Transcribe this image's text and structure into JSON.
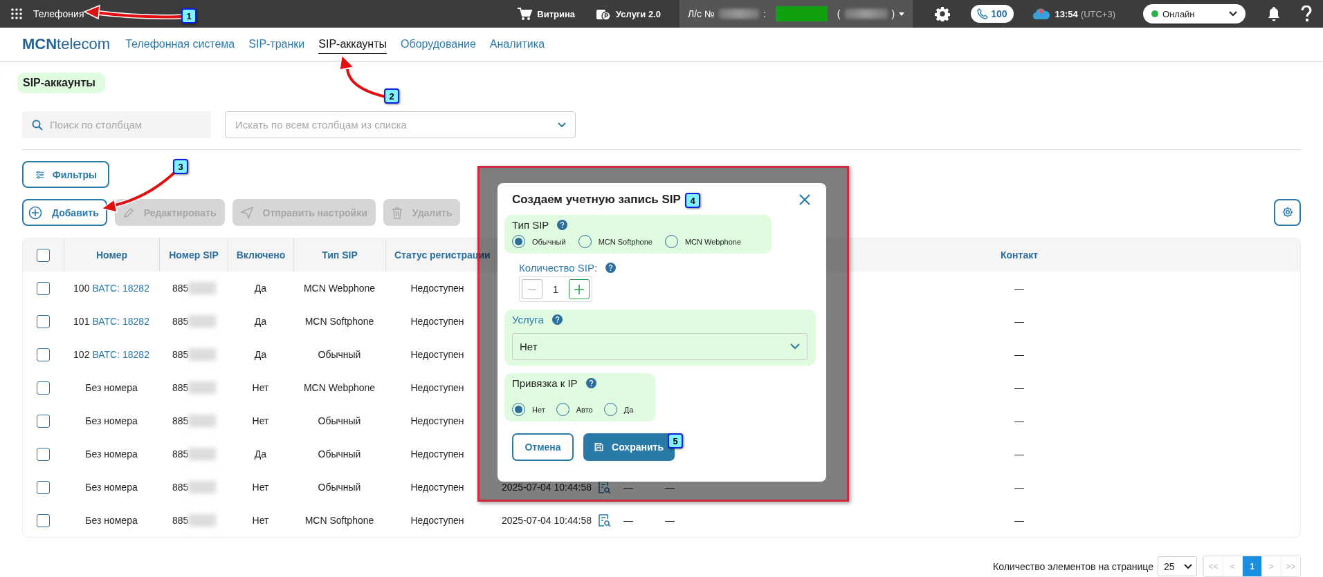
{
  "top_bar": {
    "app_title": "Телефония",
    "links": [
      {
        "label": "Витрина",
        "kind": "cart"
      },
      {
        "label": "Услуги 2.0",
        "kind": "services"
      }
    ],
    "account": {
      "prefix": "Л/с №",
      "separator": ":",
      "open_paren": "(",
      "close_paren": ")"
    },
    "calls_count": "100",
    "time": "13:54",
    "timezone": "(UTC+3)",
    "status": "Онлайн"
  },
  "brand": {
    "strong": "MCN",
    "light": "telecom"
  },
  "nav": [
    {
      "label": "Телефонная система",
      "selected": false
    },
    {
      "label": "SIP-транки",
      "selected": false
    },
    {
      "label": "SIP-аккаунты",
      "selected": true
    },
    {
      "label": "Оборудование",
      "selected": false
    },
    {
      "label": "Аналитика",
      "selected": false
    }
  ],
  "page_title": "SIP-аккаунты",
  "column_search": {
    "placeholder": "Поиск по столбцам"
  },
  "all_columns_search": {
    "placeholder": "Искать по всем столбцам из списка"
  },
  "filters_button": "Фильтры",
  "actions": [
    {
      "label": "Добавить",
      "kind": "add",
      "disabled": false
    },
    {
      "label": "Редактировать",
      "kind": "edit",
      "disabled": true
    },
    {
      "label": "Отправить настройки",
      "kind": "send",
      "disabled": true
    },
    {
      "label": "Удалить",
      "kind": "delete",
      "disabled": true
    }
  ],
  "table": {
    "select_all_checked": false,
    "columns": [
      "Номер",
      "Номер SIP",
      "Включено",
      "Тип SIP",
      "Статус регистрации",
      "Контакт"
    ],
    "rows": [
      {
        "checked": false,
        "number": "100",
        "link": "ВАТС: 18282",
        "sip": "885",
        "included": "Да",
        "sip_type": "MCN Webphone",
        "status": "Недоступен",
        "contact": "—"
      },
      {
        "checked": false,
        "number": "101",
        "link": "ВАТС: 18282",
        "sip": "885",
        "included": "Да",
        "sip_type": "MCN Softphone",
        "status": "Недоступен",
        "contact": "—"
      },
      {
        "checked": false,
        "number": "102",
        "link": "ВАТС: 18282",
        "sip": "885",
        "included": "Да",
        "sip_type": "Обычный",
        "status": "Недоступен",
        "contact": "—"
      },
      {
        "checked": false,
        "number": "Без номера",
        "sip": "885",
        "included": "Нет",
        "sip_type": "MCN Webphone",
        "status": "Недоступен",
        "contact": "—"
      },
      {
        "checked": false,
        "number": "Без номера",
        "sip": "885",
        "included": "Нет",
        "sip_type": "Обычный",
        "status": "Недоступен",
        "contact": "—"
      },
      {
        "checked": false,
        "number": "Без номера",
        "sip": "885",
        "included": "Да",
        "sip_type": "Обычный",
        "status": "Недоступен",
        "contact": "—"
      },
      {
        "checked": false,
        "number": "Без номера",
        "sip": "885",
        "included": "Нет",
        "sip_type": "Обычный",
        "status": "Недоступен",
        "date": "2025-07-04 10:44:58",
        "column_8": "—",
        "column_9": "—",
        "contact": "—"
      },
      {
        "checked": false,
        "number": "Без номера",
        "sip": "885",
        "included": "Нет",
        "sip_type": "MCN Softphone",
        "status": "Недоступен",
        "date": "2025-07-04 10:44:58",
        "column_8": "—",
        "column_9": "—",
        "contact": "—"
      }
    ]
  },
  "pagination": {
    "label": "Количество элементов на странице",
    "page_size": "25",
    "pages": [
      {
        "label": "<<",
        "selected": false
      },
      {
        "label": "<",
        "selected": false
      },
      {
        "label": "1",
        "selected": true
      },
      {
        "label": ">",
        "selected": false
      },
      {
        "label": ">>",
        "selected": false
      }
    ]
  },
  "modal": {
    "title": "Создаем учетную запись SIP",
    "sip_type": {
      "label": "Тип SIP",
      "options": [
        {
          "label": "Обычный",
          "selected": true
        },
        {
          "label": "MCN Softphone",
          "selected": false
        },
        {
          "label": "MCN Webphone",
          "selected": false
        }
      ]
    },
    "count": {
      "label": "Количество SIP:",
      "value": "1"
    },
    "service": {
      "label": "Услуга",
      "value": "Нет"
    },
    "ip_binding": {
      "label": "Привязка к IP",
      "options": [
        {
          "label": "Нет",
          "selected": true
        },
        {
          "label": "Авто",
          "selected": false
        },
        {
          "label": "Да",
          "selected": false
        }
      ]
    },
    "buttons": [
      {
        "label": "Отмена",
        "kind": "secondary"
      },
      {
        "label": "Сохранить",
        "kind": "primary"
      }
    ]
  },
  "callouts": [
    "1",
    "2",
    "3",
    "4",
    "5"
  ]
}
